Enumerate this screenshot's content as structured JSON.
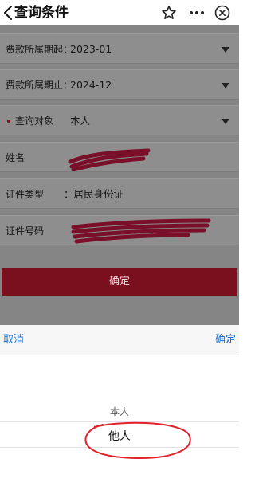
{
  "header": {
    "title": "查询条件",
    "icons": [
      "back-chevron-icon",
      "star-icon",
      "more-icon",
      "close-circle-icon"
    ]
  },
  "form": {
    "fee_period_start": {
      "label": "费款所属期起：",
      "value": "2023-01"
    },
    "fee_period_end": {
      "label": "费款所属期止：",
      "value": "2024-12"
    },
    "query_target": {
      "label": "查询对象",
      "value": "本人",
      "required_mark_color": "#7a0f1e"
    },
    "name": {
      "label": "姓名"
    },
    "id_type": {
      "label": "证件类型",
      "value": "：居民身份证"
    },
    "id_number": {
      "label": "证件号码"
    },
    "confirm_label": "确定"
  },
  "picker": {
    "cancel_label": "取消",
    "confirm_label": "确定",
    "options": [
      "本人",
      "他人"
    ],
    "selected": "他人"
  },
  "colors": {
    "accent": "#7a0f1e",
    "picker_action": "#1a6fd1",
    "annotation": "#e2212b",
    "overlay": "#858585"
  }
}
